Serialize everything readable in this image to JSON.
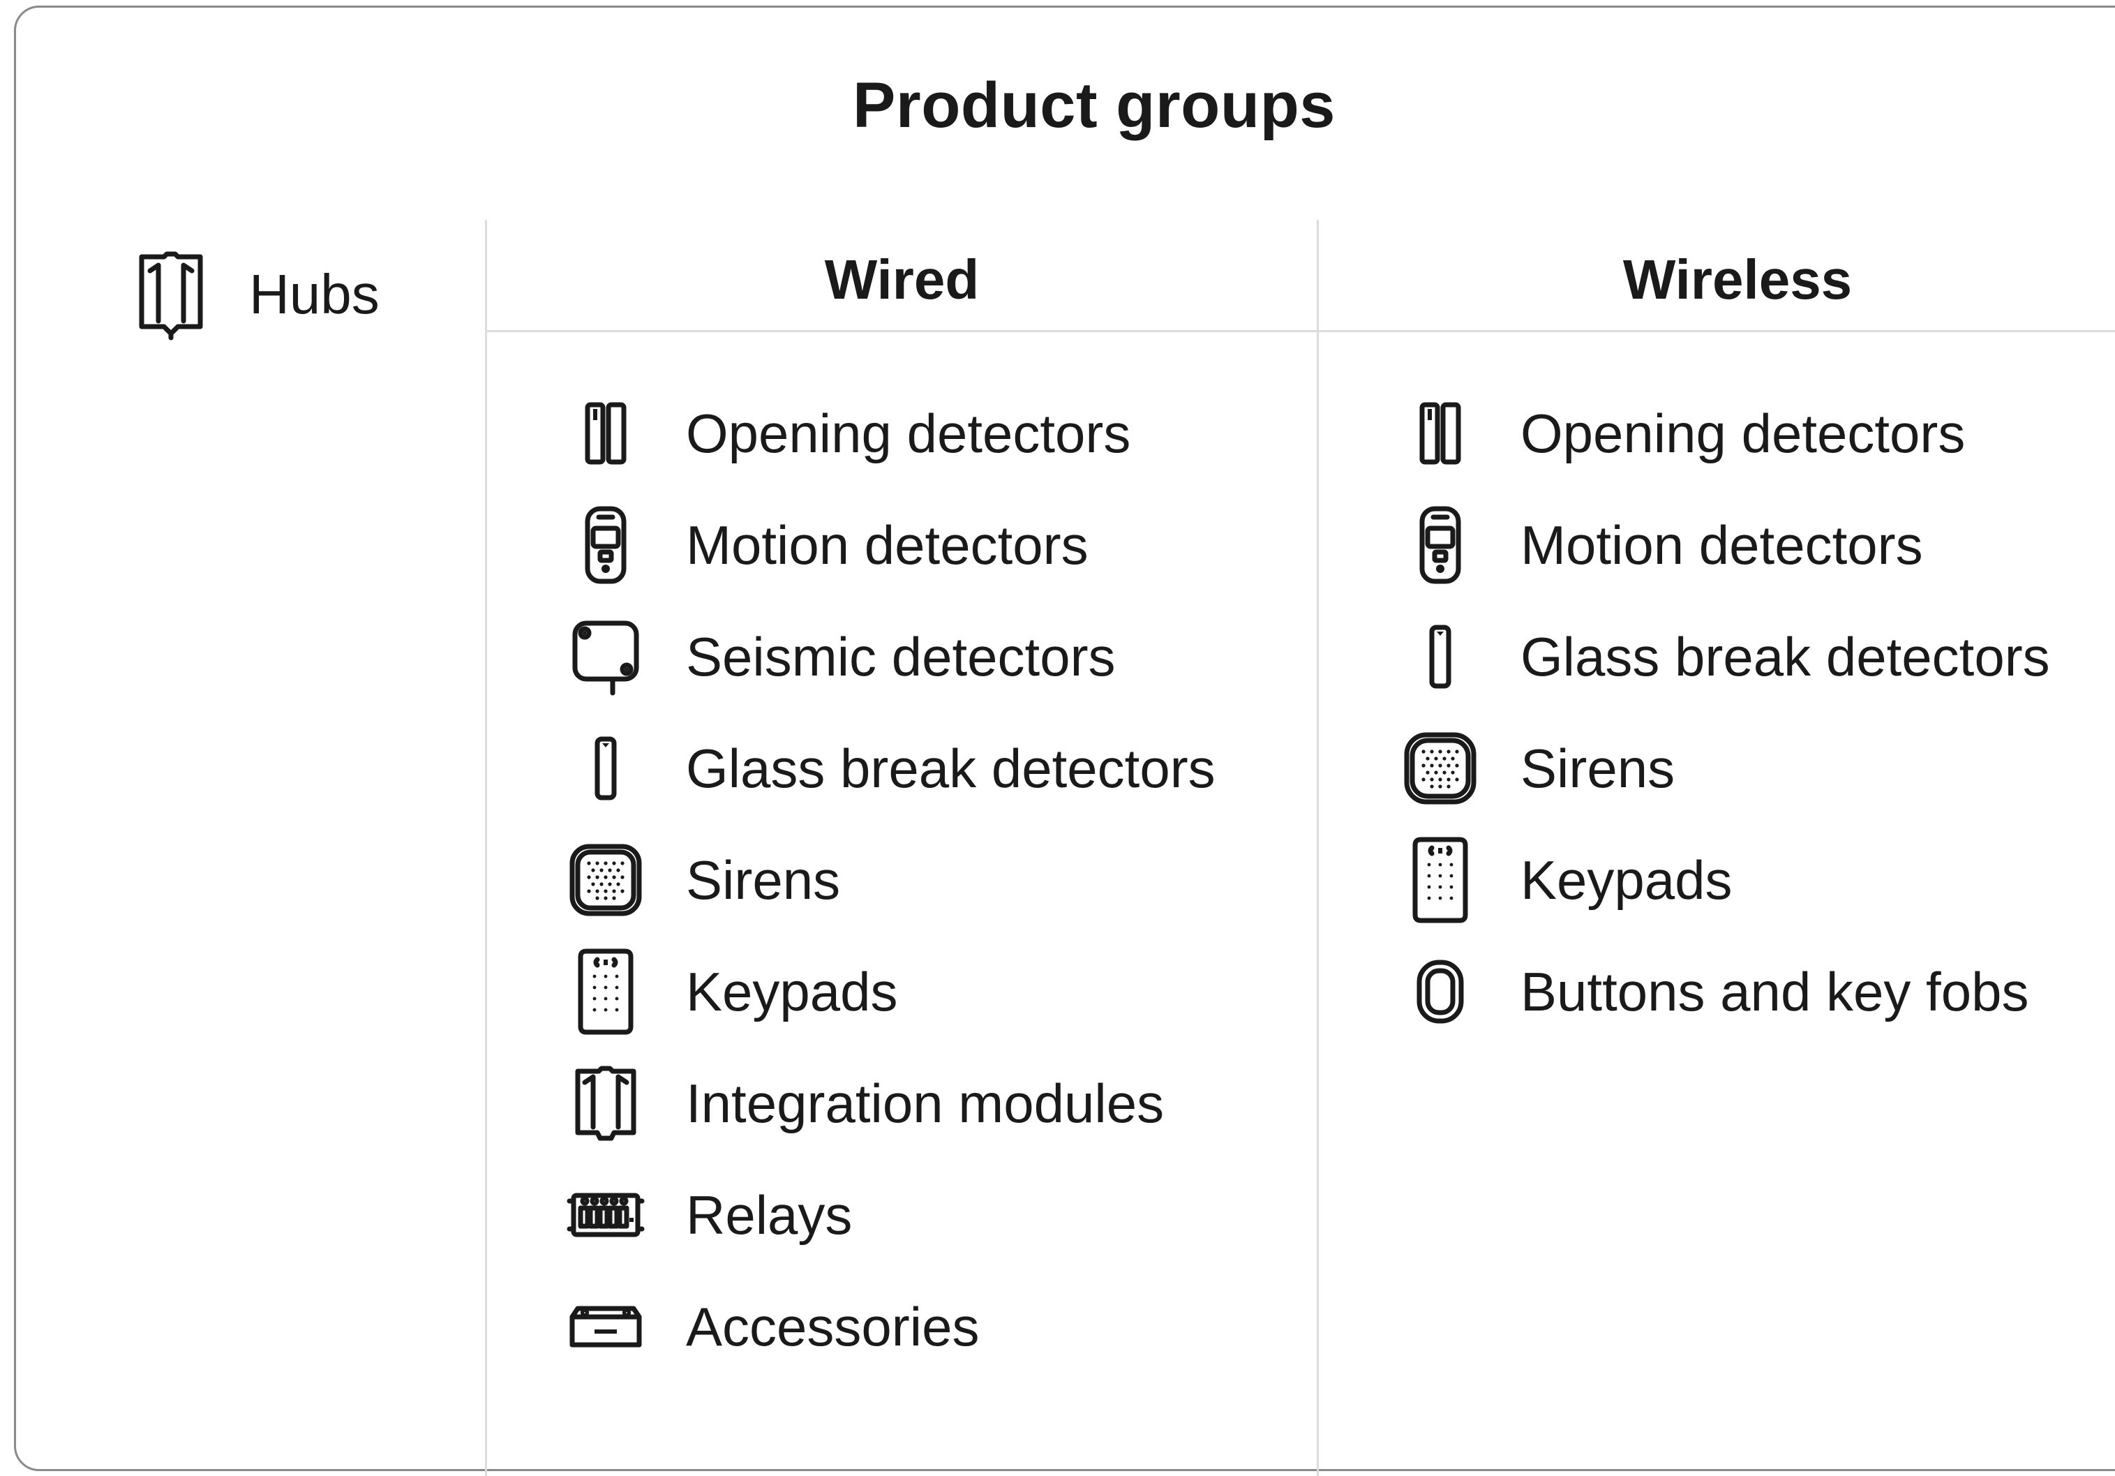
{
  "title": "Product groups",
  "hubs": {
    "label": "Hubs",
    "icon": "hub-icon"
  },
  "wired": {
    "heading": "Wired",
    "items": [
      {
        "label": "Opening detectors",
        "icon": "opening-detector-icon"
      },
      {
        "label": "Motion detectors",
        "icon": "motion-detector-icon"
      },
      {
        "label": "Seismic detectors",
        "icon": "seismic-detector-icon"
      },
      {
        "label": "Glass break detectors",
        "icon": "glass-break-detector-icon"
      },
      {
        "label": "Sirens",
        "icon": "siren-icon"
      },
      {
        "label": "Keypads",
        "icon": "keypad-icon"
      },
      {
        "label": "Integration modules",
        "icon": "integration-module-icon"
      },
      {
        "label": "Relays",
        "icon": "relay-icon"
      },
      {
        "label": "Accessories",
        "icon": "accessory-icon"
      }
    ]
  },
  "wireless": {
    "heading": "Wireless",
    "items": [
      {
        "label": "Opening detectors",
        "icon": "opening-detector-icon"
      },
      {
        "label": "Motion detectors",
        "icon": "motion-detector-icon"
      },
      {
        "label": "Glass break detectors",
        "icon": "glass-break-detector-icon"
      },
      {
        "label": "Sirens",
        "icon": "siren-icon"
      },
      {
        "label": "Keypads",
        "icon": "keypad-icon"
      },
      {
        "label": "Buttons and key fobs",
        "icon": "button-key-fob-icon"
      }
    ]
  },
  "colors": {
    "text": "#1a1a1a",
    "divider": "#dcdcdc",
    "card_border": "#8a8a8a"
  }
}
